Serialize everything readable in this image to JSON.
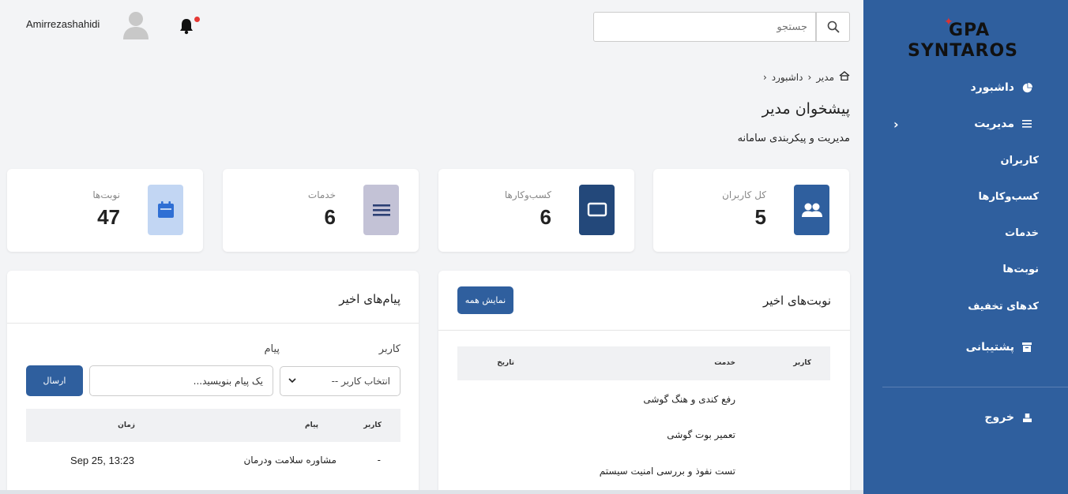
{
  "header": {
    "username": "Amirrezashahidi",
    "search_placeholder": "جستجو"
  },
  "sidebar": {
    "logo_line1": "GPA",
    "logo_line2": "SYNTAROS",
    "items": [
      {
        "label": "داشبورد",
        "icon": "pie-chart-icon"
      },
      {
        "label": "مدیریت",
        "icon": "menu-icon"
      },
      {
        "label": "پشتیبانی",
        "icon": "archive-icon"
      },
      {
        "label": "خروج",
        "icon": "logout-icon"
      }
    ],
    "submenu": [
      "کاربران",
      "کسب‌وکارها",
      "خدمات",
      "نوبت‌ها",
      "کدهای تخفیف"
    ]
  },
  "breadcrumb": {
    "home": "مدیر",
    "current": "داشبورد"
  },
  "page": {
    "title": "پیشخوان مدیر",
    "subtitle": "مدیریت و پیکربندی سامانه"
  },
  "stats": [
    {
      "label": "کل کاربران",
      "value": "5",
      "icon": "users-icon",
      "color": "#2f5f9e"
    },
    {
      "label": "کسب‌وکارها",
      "value": "6",
      "icon": "monitor-icon",
      "color": "#23487a"
    },
    {
      "label": "خدمات",
      "value": "6",
      "icon": "list-icon",
      "color": "#c3c2d6"
    },
    {
      "label": "نوبت‌ها",
      "value": "47",
      "icon": "calendar-icon",
      "color": "#c2d6f3"
    }
  ],
  "appointments": {
    "title": "نوبت‌های اخیر",
    "show_all": "نمایش همه",
    "columns": [
      "کاربر",
      "خدمت",
      "تاریخ"
    ],
    "rows": [
      {
        "service": "رفع کندی و هنگ گوشی"
      },
      {
        "service": "تعمیر بوت گوشی"
      },
      {
        "service": "تست نفوذ و بررسی امنیت سیستم"
      }
    ]
  },
  "messages": {
    "title": "پیام‌های اخیر",
    "user_label": "کاربر",
    "message_label": "پیام",
    "select_placeholder": "انتخاب کاربر --",
    "message_placeholder": "یک پیام بنویسید...",
    "send": "ارسال",
    "columns": [
      "کاربر",
      "پیام",
      "زمان"
    ],
    "rows": [
      {
        "user": "-",
        "message": "مشاوره سلامت ودرمان",
        "time": "Sep 25, 13:23"
      }
    ]
  }
}
